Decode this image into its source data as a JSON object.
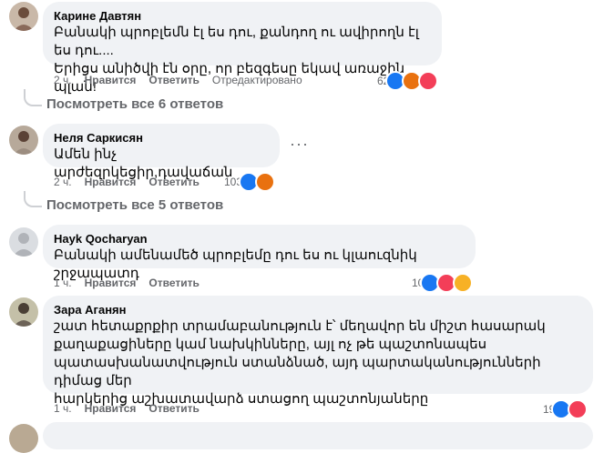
{
  "comments": [
    {
      "author": "Карине Давтян",
      "text": "Բանակի պրոբլեմն էլ ես դու, քանդող ու ավիրողն էլ ես դու....\nԵրիցս անիծվի էն օրը, որ բեզգեսը եկավ առաջին պլան!",
      "time": "2 ч.",
      "like_label": "Нравится",
      "reply_label": "Ответить",
      "edited_label": "Отредактировано",
      "reaction_count": "62",
      "reactions": [
        "like-icon",
        "angry-icon",
        "love-icon"
      ]
    },
    {
      "author": "Неля Саркисян",
      "text": "Ամեն ինչ արժեզրկեցիր,դավաճան",
      "time": "2 ч.",
      "like_label": "Нравится",
      "reply_label": "Ответить",
      "reaction_count": "103",
      "reactions": [
        "like-icon",
        "angry-icon"
      ]
    },
    {
      "author": "Hayk Qocharyan",
      "text": "Բանակի ամենամեծ պրոբլեմը դու ես ու կլաուզնիկ շրջապատդ",
      "time": "1 ч.",
      "like_label": "Нравится",
      "reply_label": "Ответить",
      "reaction_count": "10",
      "reactions": [
        "like-icon",
        "love-icon",
        "care-icon"
      ]
    },
    {
      "author": "Зара Аганян",
      "text": "շատ հետաքրքիր տրամաբանություն է՝ մեղավոր են միշտ հասարակ\nքաղաքացիները կամ նախկինները, այլ ոչ թե պաշտոնապես\nպատասխանատվություն ստանձնած, այդ պարտականությունների դիմաց մեր\nհարկերից աշխատավարձ ստացող պաշտոնյաները",
      "time": "1 ч.",
      "like_label": "Нравится",
      "reply_label": "Ответить",
      "reaction_count": "19",
      "reactions": [
        "like-icon",
        "love-icon"
      ]
    }
  ],
  "view_more": [
    "Посмотреть все 6 ответов",
    "Посмотреть все 5 ответов"
  ],
  "colors": {
    "bubble": "#f0f2f5",
    "secondary_text": "#65676b",
    "like": "#1877f2",
    "love": "#f33e58",
    "angry": "#e9710f"
  }
}
